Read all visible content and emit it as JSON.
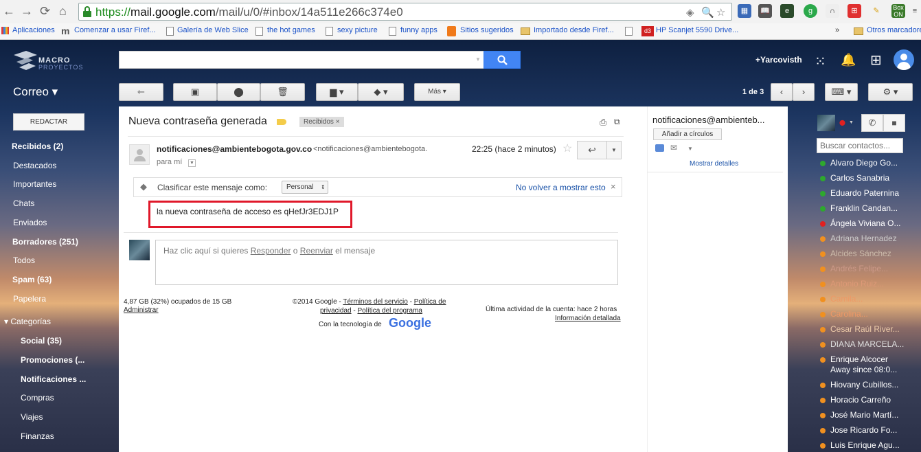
{
  "browser": {
    "url_scheme": "https://",
    "url_host": "mail.google.com",
    "url_path": "/mail/u/0/#inbox/14a511e266c374e0",
    "bookmarks": [
      {
        "label": "Aplicaciones"
      },
      {
        "label": "Comenzar a usar Firef..."
      },
      {
        "label": "Galería de Web Slice"
      },
      {
        "label": "the hot games"
      },
      {
        "label": "sexy picture"
      },
      {
        "label": "funny apps"
      },
      {
        "label": "Sitios sugeridos"
      },
      {
        "label": "Importado desde Firef..."
      },
      {
        "label": "HP Scanjet 5590 Drive..."
      }
    ],
    "more_bookmarks": "»",
    "other_bookmarks": "Otros marcadores"
  },
  "header": {
    "logo_text": "MACRO",
    "logo_sub": "PROYECTOS",
    "user": "+Yarcovisth"
  },
  "toolbar": {
    "app_label": "Correo ▾",
    "mas_label": "Más ▾",
    "pager": "1 de 3"
  },
  "sidebar": {
    "compose": "REDACTAR",
    "items": [
      {
        "label": "Recibidos (2)"
      },
      {
        "label": "Destacados"
      },
      {
        "label": "Importantes"
      },
      {
        "label": "Chats"
      },
      {
        "label": "Enviados"
      },
      {
        "label": "Borradores (251)"
      },
      {
        "label": "Todos"
      },
      {
        "label": "Spam (63)"
      },
      {
        "label": "Papelera"
      },
      {
        "label": "▾ Categorías"
      },
      {
        "label": "Social (35)"
      },
      {
        "label": "Promociones (..."
      },
      {
        "label": "Notificaciones ..."
      },
      {
        "label": "Compras"
      },
      {
        "label": "Viajes"
      },
      {
        "label": "Finanzas"
      }
    ]
  },
  "email": {
    "subject": "Nueva contraseña generada",
    "inbox_label": "Recibidos",
    "sender_name": "notificaciones@ambientebogota.gov.co",
    "sender_email": "<notificaciones@ambientebogota.",
    "to": "para mí",
    "time": "22:25 (hace 2 minutos)",
    "classify_label": "Clasificar este mensaje como:",
    "classify_value": "Personal",
    "dont_show": "No volver a mostrar esto",
    "body": "la nueva contraseña de acceso es qHefJr3EDJ1P",
    "reply_prefix": "Haz clic aquí si quieres ",
    "reply_link": "Responder",
    "reply_mid": " o ",
    "forward_link": "Reenviar",
    "reply_suffix": " el mensaje"
  },
  "footer": {
    "storage": "4,87 GB (32%) ocupados de 15 GB",
    "manage": "Administrar",
    "copyright": "©2014 Google - ",
    "terms": "Términos del servicio",
    "sep1": " - ",
    "privacy_a": "Política de",
    "privacy_b": "privacidad",
    "sep2": " - ",
    "program": "Política del programa",
    "powered": "Con la tecnología de",
    "google": "Google",
    "last_activity": "Última actividad de la cuenta: hace 2 horas",
    "details": "Información detallada"
  },
  "right_panel": {
    "sender": "notificaciones@ambienteb...",
    "add_circles": "Añadir a círculos",
    "show_details": "Mostrar detalles"
  },
  "contacts": {
    "search_placeholder": "Buscar contactos...",
    "list": [
      {
        "name": "Alvaro Diego Go...",
        "status": "g"
      },
      {
        "name": "Carlos Sanabria",
        "status": "g"
      },
      {
        "name": "Eduardo Paternina",
        "status": "g"
      },
      {
        "name": "Franklin Candan...",
        "status": "g"
      },
      {
        "name": "Ángela Viviana O...",
        "status": "r"
      },
      {
        "name": "Adriana Hernadez",
        "status": "o"
      },
      {
        "name": "Alcides Sánchez",
        "status": "o"
      },
      {
        "name": "Andrés Felipe...",
        "status": "o"
      },
      {
        "name": "Antonio Ruiz...",
        "status": "o"
      },
      {
        "name": "Camila...",
        "status": "o"
      },
      {
        "name": "Carolina...",
        "status": "o"
      },
      {
        "name": "Cesar Raúl River...",
        "status": "o"
      },
      {
        "name": "DIANA MARCELA...",
        "status": "o"
      },
      {
        "name": "Enrique Alcocer",
        "status": "o"
      },
      {
        "name": "Hiovany Cubillos...",
        "status": "o"
      },
      {
        "name": "Horacio Carreño",
        "status": "o"
      },
      {
        "name": "José Mario Martí...",
        "status": "o"
      },
      {
        "name": "Jose Ricardo Fo...",
        "status": "o"
      },
      {
        "name": "Luis Enrique Agu...",
        "status": "o"
      }
    ],
    "away_note": "Away since 08:0..."
  }
}
